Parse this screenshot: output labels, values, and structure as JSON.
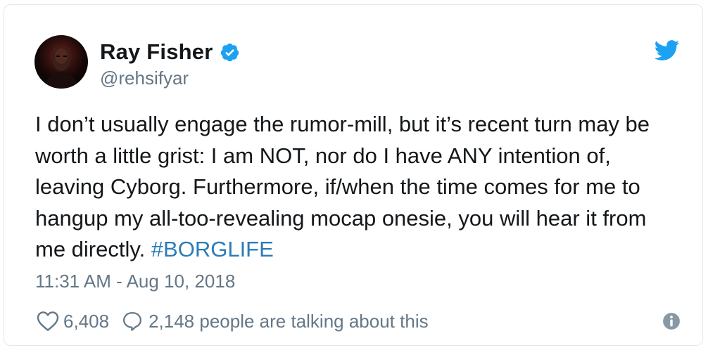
{
  "author": {
    "name": "Ray Fisher",
    "handle": "@rehsifyar",
    "verified": true
  },
  "tweet": {
    "lines": [
      "I don’t usually engage the rumor-mill, but it’s recent turn may be",
      "worth a little grist: I am NOT, nor do I have ANY intention of,",
      "leaving Cyborg. Furthermore, if/when the time comes for me to",
      "hangup my all-too-revealing mocap onesie, you will hear it from"
    ],
    "last_line_prefix": "me directly. ",
    "hashtag": "#BORGLIFE",
    "timestamp": "11:31 AM - Aug 10, 2018"
  },
  "stats": {
    "likes": "6,408",
    "talking": "2,148 people are talking about this"
  },
  "colors": {
    "text": "#14171a",
    "secondary": "#657786",
    "link": "#2b7bb9",
    "brand": "#1da1f2",
    "border": "#e1e8ed"
  },
  "icons": {
    "verified": "verified-badge-icon",
    "brand": "twitter-bird-icon",
    "like": "heart-icon",
    "reply": "speech-bubble-icon",
    "info": "info-icon"
  }
}
